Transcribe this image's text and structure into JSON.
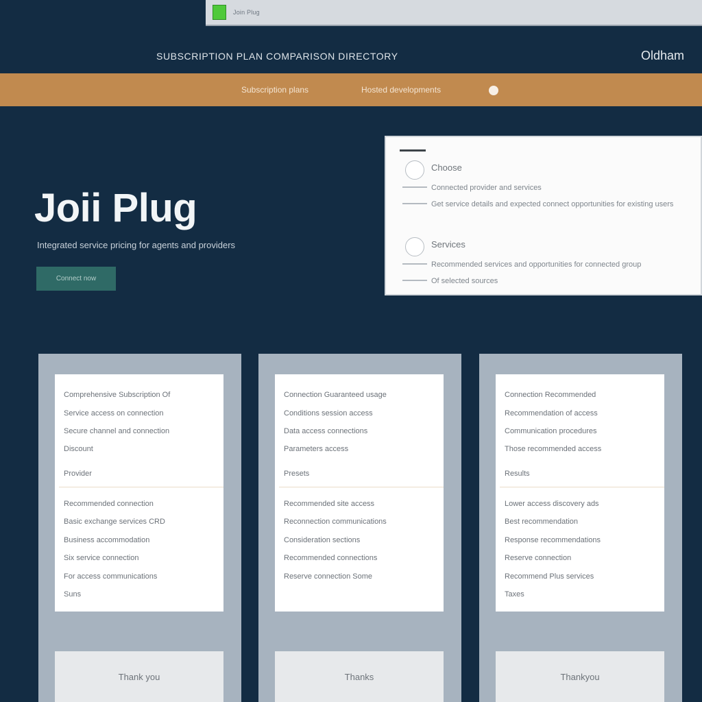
{
  "browser": {
    "tab_title": "Join Plug",
    "favicon_color": "#4fc93a"
  },
  "topnav": {
    "title": "SUBSCRIPTION PLAN COMPARISON DIRECTORY",
    "account": "Oldham"
  },
  "orange_bar": {
    "links": [
      "Subscription plans",
      "Hosted developments"
    ],
    "color": "#c18a4f"
  },
  "hero": {
    "title": "Joii Plug",
    "subtitle": "Integrated service pricing for agents and providers",
    "button_label": "Connect now"
  },
  "form": {
    "fields": [
      {
        "label": "Choose",
        "lines": [
          "Connected provider and services",
          "Get service details and expected connect opportunities for existing users"
        ]
      },
      {
        "label": "Services",
        "lines": [
          "Recommended services and opportunities for connected group",
          "Of selected sources"
        ]
      }
    ]
  },
  "columns": [
    {
      "lines_top": [
        "Comprehensive Subscription Of",
        "Service access on connection",
        "Secure channel and connection",
        "Discount",
        "Provider"
      ],
      "lines_bottom": [
        "Recommended connection",
        "Basic exchange services CRD",
        "Business accommodation",
        "Six service connection",
        "For access communications",
        "Suns"
      ],
      "button_label": "Thank you"
    },
    {
      "lines_top": [
        "Connection Guaranteed usage",
        "Conditions session access",
        "Data access connections",
        "Parameters access"
      ],
      "lines_bottom": [
        "Recommended site access",
        "Reconnection communications",
        "Consideration sections",
        "Recommended connections",
        "Reserve connection Some"
      ],
      "button_label": "Thanks",
      "section_label": "Presets"
    },
    {
      "lines_top": [
        "Connection Recommended",
        "Recommendation of access",
        "Communication procedures",
        "Those recommended access"
      ],
      "lines_bottom": [
        "Lower access discovery ads",
        "Best recommendation",
        "Response recommendations",
        "Reserve connection",
        "Recommend Plus services",
        "Taxes"
      ],
      "button_label": "Thankyou",
      "section_label": "Results"
    }
  ]
}
